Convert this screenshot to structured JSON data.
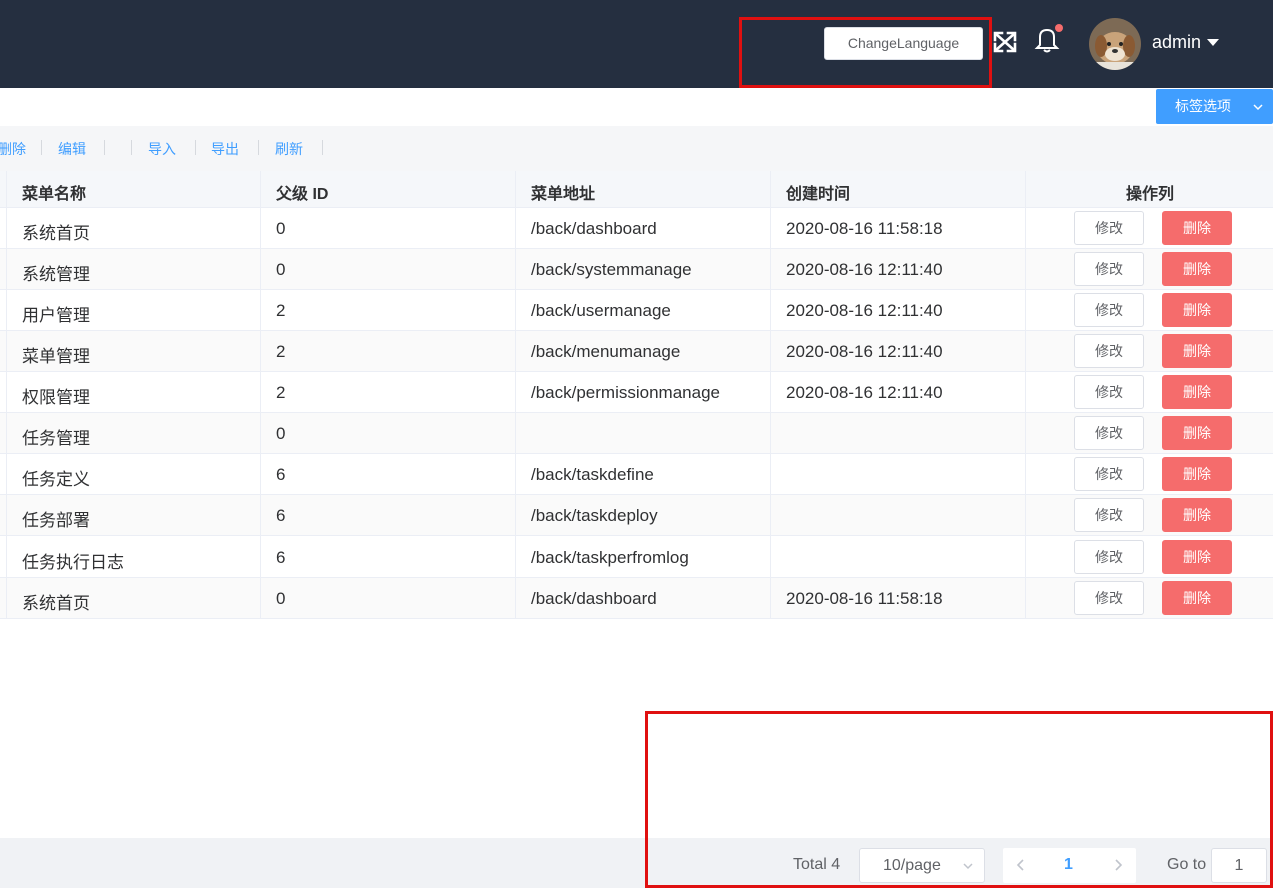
{
  "header": {
    "change_language_label": "ChangeLanguage",
    "user_name": "admin",
    "notification_dot": true,
    "colors": {
      "background": "#252f40",
      "dot": "#f56c6c"
    }
  },
  "tags_bar": {
    "options_label": "标签选项"
  },
  "toolbar": {
    "delete_label": "删除",
    "edit_label": "编辑",
    "import_label": "导入",
    "export_label": "导出",
    "refresh_label": "刷新"
  },
  "table": {
    "columns": [
      "菜单名称",
      "父级 ID",
      "菜单地址",
      "创建时间",
      "操作列"
    ],
    "edit_label": "修改",
    "delete_label": "删除",
    "rows": [
      {
        "name": "系统首页",
        "parent_id": "0",
        "path": "/back/dashboard",
        "created": "2020-08-16 11:58:18"
      },
      {
        "name": "系统管理",
        "parent_id": "0",
        "path": "/back/systemmanage",
        "created": "2020-08-16 12:11:40"
      },
      {
        "name": "用户管理",
        "parent_id": "2",
        "path": "/back/usermanage",
        "created": "2020-08-16 12:11:40"
      },
      {
        "name": "菜单管理",
        "parent_id": "2",
        "path": "/back/menumanage",
        "created": "2020-08-16 12:11:40"
      },
      {
        "name": "权限管理",
        "parent_id": "2",
        "path": "/back/permissionmanage",
        "created": "2020-08-16 12:11:40"
      },
      {
        "name": "任务管理",
        "parent_id": "0",
        "path": "",
        "created": ""
      },
      {
        "name": "任务定义",
        "parent_id": "6",
        "path": "/back/taskdefine",
        "created": ""
      },
      {
        "name": "任务部署",
        "parent_id": "6",
        "path": "/back/taskdeploy",
        "created": ""
      },
      {
        "name": "任务执行日志",
        "parent_id": "6",
        "path": "/back/taskperfromlog",
        "created": ""
      },
      {
        "name": "系统首页",
        "parent_id": "0",
        "path": "/back/dashboard",
        "created": "2020-08-16 11:58:18"
      }
    ]
  },
  "pagination": {
    "total_text": "Total 4",
    "page_size": "10/page",
    "current_page": "1",
    "goto_label": "Go to",
    "goto_value": "1"
  },
  "icons": [
    "fullscreen-icon",
    "bell-icon",
    "caret-down-icon",
    "chevron-down-icon",
    "chevron-left-icon",
    "chevron-right-icon"
  ]
}
